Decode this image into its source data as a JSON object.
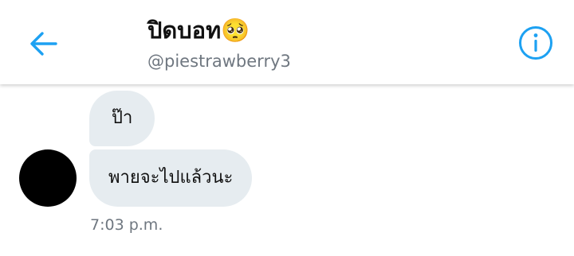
{
  "header": {
    "title": "ปิดบอท🥺",
    "handle": "@piestrawberry3",
    "back_icon": "back-arrow-icon",
    "info_icon": "info-icon"
  },
  "messages": [
    {
      "text": "ป๊า"
    },
    {
      "text": "พายจะไปแล้วนะ"
    }
  ],
  "timestamp": "7:03 p.m.",
  "colors": {
    "accent": "#1da1f2",
    "bubble": "#e6ecf0",
    "secondary_text": "#6f7780"
  }
}
